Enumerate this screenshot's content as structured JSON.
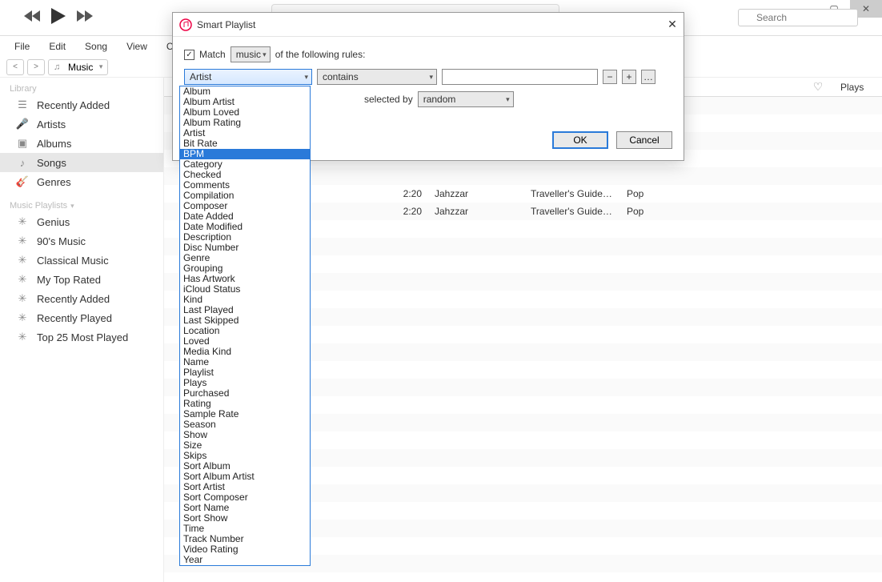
{
  "window": {
    "title": ""
  },
  "search": {
    "placeholder": "Search"
  },
  "menus": [
    "File",
    "Edit",
    "Song",
    "View",
    "Controls"
  ],
  "library_selector": "Music",
  "sidebar": {
    "library_header": "Library",
    "library_items": [
      {
        "label": "Recently Added",
        "icon": "list"
      },
      {
        "label": "Artists",
        "icon": "mic"
      },
      {
        "label": "Albums",
        "icon": "disc"
      },
      {
        "label": "Songs",
        "icon": "note",
        "selected": true
      },
      {
        "label": "Genres",
        "icon": "guitar"
      }
    ],
    "playlists_header": "Music Playlists",
    "playlist_items": [
      {
        "label": "Genius"
      },
      {
        "label": "90's Music"
      },
      {
        "label": "Classical Music"
      },
      {
        "label": "My Top Rated"
      },
      {
        "label": "Recently Added"
      },
      {
        "label": "Recently Played"
      },
      {
        "label": "Top 25 Most Played"
      }
    ]
  },
  "columns": {
    "plays": "Plays"
  },
  "tracks": [
    {
      "time": "2:20",
      "artist": "Jahzzar",
      "album": "Traveller's Guide (E...",
      "genre": "Pop"
    },
    {
      "time": "2:20",
      "artist": "Jahzzar",
      "album": "Traveller's Guide (E...",
      "genre": "Pop"
    }
  ],
  "dialog": {
    "title": "Smart Playlist",
    "match_label": "Match",
    "match_type": "music",
    "match_suffix": "of the following rules:",
    "rule_field": "Artist",
    "rule_op": "contains",
    "rule_value": "",
    "limit_label": "",
    "selected_by_label": "selected by",
    "selected_by_value": "random",
    "ok": "OK",
    "cancel": "Cancel"
  },
  "dropdown_selected": "BPM",
  "dropdown_options": [
    "Album",
    "Album Artist",
    "Album Loved",
    "Album Rating",
    "Artist",
    "Bit Rate",
    "BPM",
    "Category",
    "Checked",
    "Comments",
    "Compilation",
    "Composer",
    "Date Added",
    "Date Modified",
    "Description",
    "Disc Number",
    "Genre",
    "Grouping",
    "Has Artwork",
    "iCloud Status",
    "Kind",
    "Last Played",
    "Last Skipped",
    "Location",
    "Loved",
    "Media Kind",
    "Name",
    "Playlist",
    "Plays",
    "Purchased",
    "Rating",
    "Sample Rate",
    "Season",
    "Show",
    "Size",
    "Skips",
    "Sort Album",
    "Sort Album Artist",
    "Sort Artist",
    "Sort Composer",
    "Sort Name",
    "Sort Show",
    "Time",
    "Track Number",
    "Video Rating",
    "Year"
  ]
}
